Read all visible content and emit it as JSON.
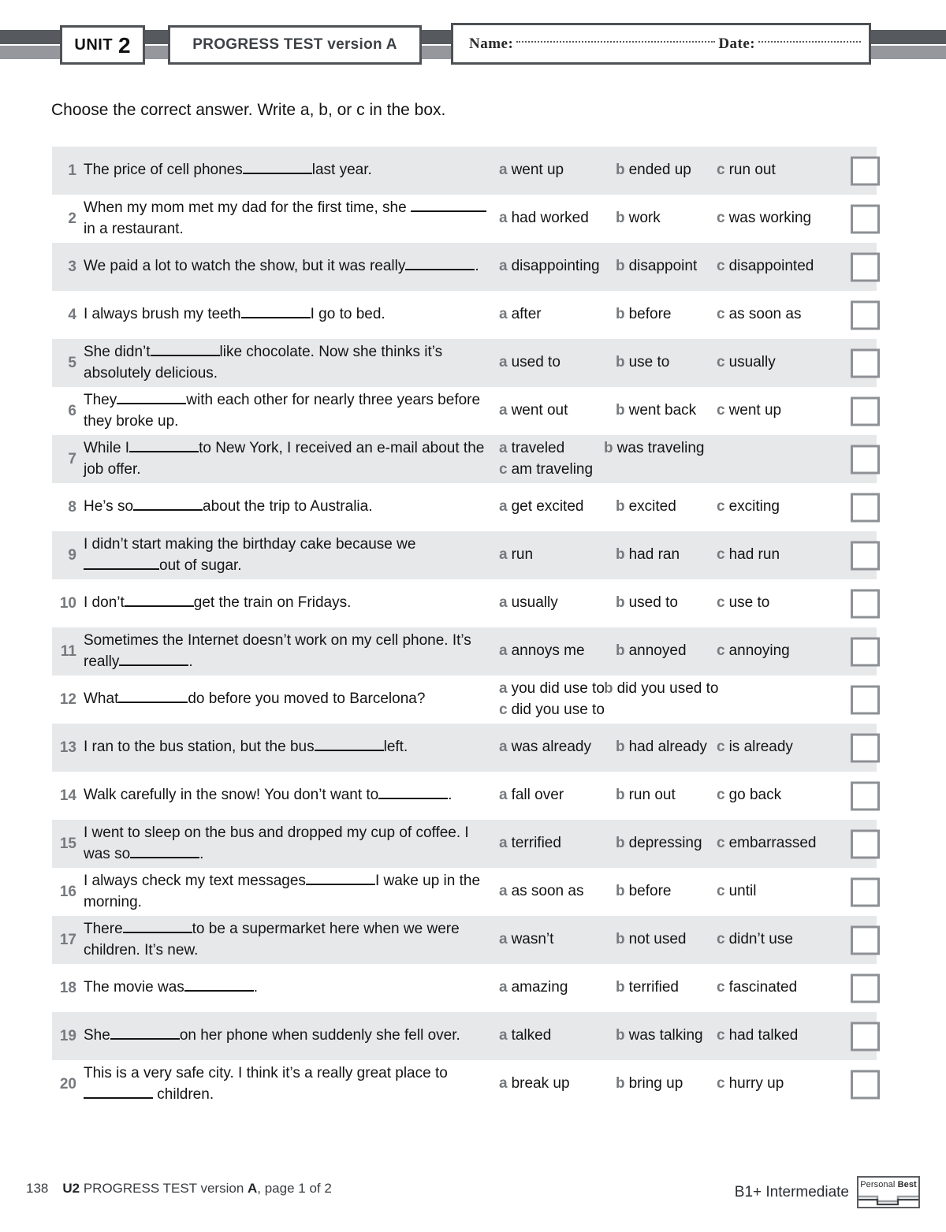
{
  "header": {
    "unit_word": "UNIT",
    "unit_number": "2",
    "test_label": "PROGRESS TEST version A",
    "name_label": "Name:",
    "date_label": "Date:"
  },
  "instruction": "Choose the correct answer. Write a, b, or c in the box.",
  "questions": [
    {
      "number": "1",
      "text_before": "The price of cell phones",
      "text_after": "last year.",
      "options": [
        "went up",
        "ended up",
        "run out"
      ],
      "letters": [
        "a",
        "b",
        "c"
      ],
      "layout": "three",
      "shaded": true
    },
    {
      "number": "2",
      "text_before": "When my mom met my dad for the first time, she ",
      "text_after": "in a restaurant.",
      "options": [
        "had worked",
        "work",
        "was working"
      ],
      "letters": [
        "a",
        "b",
        "c"
      ],
      "layout": "three",
      "shaded": false
    },
    {
      "number": "3",
      "text_before": "We paid a lot to watch the show, but it was really",
      "text_after": ".",
      "options": [
        "disappointing",
        "disappoint",
        "disappointed"
      ],
      "letters": [
        "a",
        "b",
        "c"
      ],
      "layout": "three",
      "shaded": true
    },
    {
      "number": "4",
      "text_before": "I always brush my teeth",
      "text_after": "I go to bed.",
      "options": [
        "after",
        "before",
        "as soon as"
      ],
      "letters": [
        "a",
        "b",
        "c"
      ],
      "layout": "three",
      "shaded": false
    },
    {
      "number": "5",
      "text_before": "She didn’t",
      "text_after": "like chocolate. Now she thinks it’s absolutely delicious.",
      "options": [
        "used to",
        "use to",
        "usually"
      ],
      "letters": [
        "a",
        "b",
        "c"
      ],
      "layout": "three",
      "shaded": true
    },
    {
      "number": "6",
      "text_before": "They",
      "text_after": "with each other for nearly three years before they broke up.",
      "options": [
        "went out",
        "went back",
        "went up"
      ],
      "letters": [
        "a",
        "b",
        "c"
      ],
      "layout": "three",
      "shaded": false
    },
    {
      "number": "7",
      "text_before": "While I",
      "text_after": "to New York, I received an e-mail about the job offer.",
      "options": [
        "traveled",
        "was traveling",
        "am traveling"
      ],
      "letters": [
        "a",
        "b",
        "c"
      ],
      "layout": "wrap",
      "shaded": true
    },
    {
      "number": "8",
      "text_before": "He’s so",
      "text_after": "about the trip to Australia.",
      "options": [
        "get excited",
        "excited",
        "exciting"
      ],
      "letters": [
        "a",
        "b",
        "c"
      ],
      "layout": "three",
      "shaded": false
    },
    {
      "number": "9",
      "text_before": "I didn’t start making the birthday cake because we ",
      "text_after": "out of sugar.",
      "options": [
        "run",
        "had ran",
        "had run"
      ],
      "letters": [
        "a",
        "b",
        "c"
      ],
      "layout": "three",
      "shaded": true
    },
    {
      "number": "10",
      "text_before": "I don’t",
      "text_after": "get the train on Fridays.",
      "options": [
        "usually",
        "used to",
        "use to"
      ],
      "letters": [
        "a",
        "b",
        "c"
      ],
      "layout": "three",
      "shaded": false
    },
    {
      "number": "11",
      "text_before": "Sometimes the Internet doesn’t work on my cell phone. It’s really",
      "text_after": ".",
      "options": [
        "annoys me",
        "annoyed",
        "annoying"
      ],
      "letters": [
        "a",
        "b",
        "c"
      ],
      "layout": "three",
      "shaded": true
    },
    {
      "number": "12",
      "text_before": "What",
      "text_after": "do before you moved to Barcelona?",
      "options": [
        "you did use to",
        "did you used to",
        "did you use to"
      ],
      "letters": [
        "a",
        "b",
        "c"
      ],
      "layout": "wrap",
      "shaded": false
    },
    {
      "number": "13",
      "text_before": "I ran to the bus station, but the bus",
      "text_after": "left.",
      "options": [
        "was already",
        "had already",
        "is already"
      ],
      "letters": [
        "a",
        "b",
        "c"
      ],
      "layout": "three",
      "shaded": true
    },
    {
      "number": "14",
      "text_before": "Walk carefully in the snow! You don’t want to",
      "text_after": ".",
      "options": [
        "fall over",
        "run out",
        "go back"
      ],
      "letters": [
        "a",
        "b",
        "c"
      ],
      "layout": "three",
      "shaded": false
    },
    {
      "number": "15",
      "text_before": "I went to sleep on the bus and dropped my cup of coffee. I was so",
      "text_after": ".",
      "options": [
        "terrified",
        "depressing",
        "embarrassed"
      ],
      "letters": [
        "a",
        "b",
        "c"
      ],
      "layout": "three",
      "shaded": true
    },
    {
      "number": "16",
      "text_before": "I always check my text messages",
      "text_after": "I wake up in the morning.",
      "options": [
        "as soon as",
        "before",
        "until"
      ],
      "letters": [
        "a",
        "b",
        "c"
      ],
      "layout": "three",
      "shaded": false
    },
    {
      "number": "17",
      "text_before": "There",
      "text_after": "to be a supermarket here when we were children. It’s new.",
      "options": [
        "wasn’t",
        "not used",
        "didn’t use"
      ],
      "letters": [
        "a",
        "b",
        "c"
      ],
      "layout": "three",
      "shaded": true
    },
    {
      "number": "18",
      "text_before": "The movie was",
      "text_after": ".",
      "options": [
        "amazing",
        "terrified",
        "fascinated"
      ],
      "letters": [
        "a",
        "b",
        "c"
      ],
      "layout": "three",
      "shaded": false
    },
    {
      "number": "19",
      "text_before": "She",
      "text_after": "on her phone when suddenly she fell over.",
      "options": [
        "talked",
        "was talking",
        "had talked"
      ],
      "letters": [
        "a",
        "b",
        "c"
      ],
      "layout": "three",
      "shaded": true
    },
    {
      "number": "20",
      "text_before": "This is a very safe city. I think it’s a really great place to",
      "text_after": " children.",
      "options": [
        "break up",
        "bring up",
        "hurry up"
      ],
      "letters": [
        "a",
        "b",
        "c"
      ],
      "layout": "three",
      "shaded": false
    }
  ],
  "footer": {
    "page_number": "138",
    "unit_tag": "U2",
    "title_plain": " PROGRESS TEST version ",
    "version": "A",
    "page_info": ", page 1 of 2",
    "level": "B1+ Intermediate",
    "logo_text_light": "Personal ",
    "logo_text_bold": "Best"
  },
  "colors": {
    "bar_dark": "#565a5e",
    "bar_light": "#95979c",
    "row_shade": "#e7e8ea",
    "box_border": "#8d9095",
    "number_gray": "#76797d"
  }
}
